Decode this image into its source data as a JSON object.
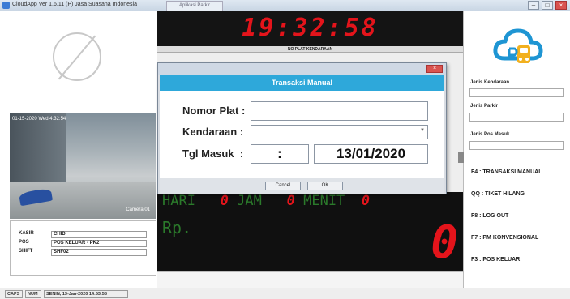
{
  "window": {
    "title": "CloudApp Ver 1.6.11 (P) Jasa Suasana Indonesia",
    "tab": "Aplikasi Parkir"
  },
  "left": {
    "camera_timestamp": "01-15-2020 Wed 4:32:54",
    "camera_label": "Camera 01",
    "info": [
      {
        "key": "KASIR",
        "value": "CHID"
      },
      {
        "key": "POS",
        "value": "POS KELUAR - PK2"
      },
      {
        "key": "SHIFT",
        "value": "SHF02"
      }
    ]
  },
  "center": {
    "clock": "19:32:58",
    "plate_label": "NO PLAT KENDARAAN",
    "hari_label": "HARI",
    "hari_value": "0",
    "jam_label": "JAM",
    "jam_value": "0",
    "menit_label": "MENIT",
    "menit_value": "0",
    "rp_label": "Rp.",
    "total": "0"
  },
  "right": {
    "jenis_kendaraan_label": "Jenis Kendaraan",
    "jenis_parkir_label": "Jenis Parkir",
    "jenis_pos_label": "Jenis Pos Masuk",
    "shortcuts": [
      "F4 : TRANSAKSI MANUAL",
      "QQ : TIKET HILANG",
      "F8 : LOG OUT",
      "F7 : PM KONVENSIONAL",
      "F3 : POS KELUAR"
    ]
  },
  "dialog": {
    "title": "Transaksi Manual",
    "close_label": "×",
    "nomor_plat_label": "Nomor Plat",
    "nomor_plat_value": "",
    "kendaraan_label": "Kendaraan",
    "kendaraan_value": "",
    "tgl_masuk_label": "Tgl Masuk",
    "colon": ":",
    "time_value": ":",
    "date_value": "13/01/2020",
    "cancel_label": "Cancel",
    "ok_label": "OK"
  },
  "statusbar": {
    "caps": "CAPS",
    "num": "NUM",
    "datetime": "SENIN, 13-Jan-2020 14:53:58"
  },
  "colors": {
    "dialog_header": "#2ea8da",
    "led_red": "#e4141b",
    "led_green": "#2b7a2b"
  }
}
